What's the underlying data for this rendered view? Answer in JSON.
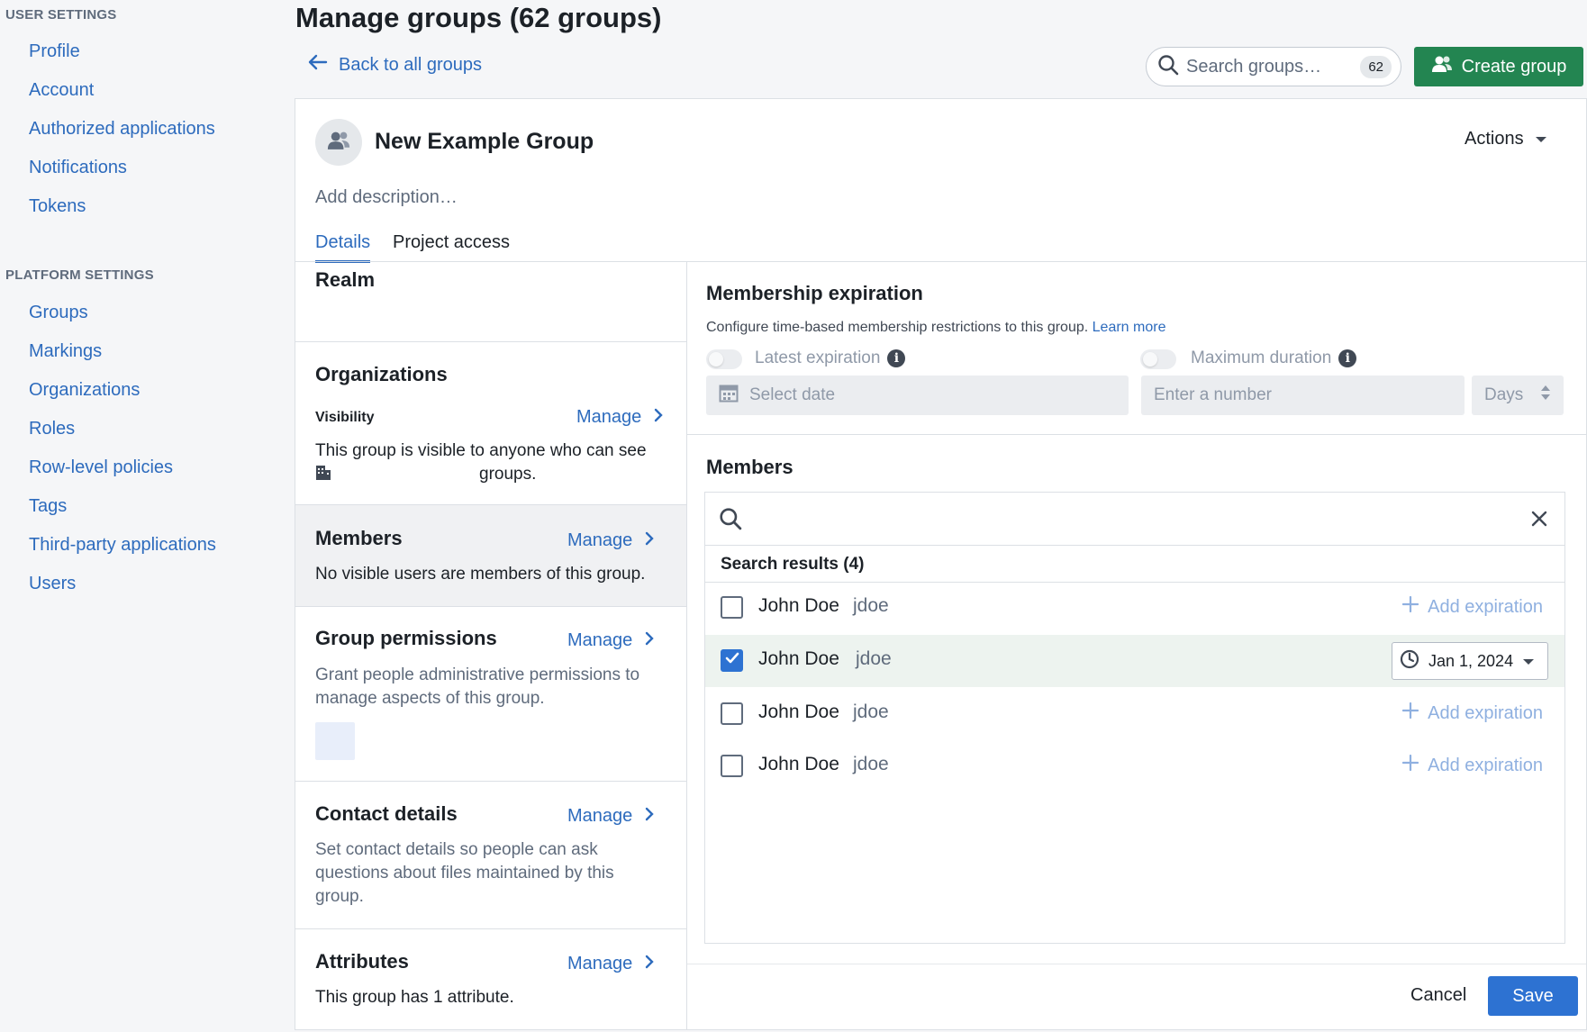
{
  "sidebar": {
    "user_heading": "USER SETTINGS",
    "user_items": [
      "Profile",
      "Account",
      "Authorized applications",
      "Notifications",
      "Tokens"
    ],
    "platform_heading": "PLATFORM SETTINGS",
    "platform_items": [
      "Groups",
      "Markings",
      "Organizations",
      "Roles",
      "Row-level policies",
      "Tags",
      "Third-party applications",
      "Users"
    ]
  },
  "header": {
    "title": "Manage groups (62 groups)",
    "back_label": "Back to all groups",
    "search_placeholder": "Search groups…",
    "search_count": "62",
    "create_label": "Create group"
  },
  "group": {
    "name": "New Example Group",
    "actions_label": "Actions",
    "description_placeholder": "Add description…",
    "tabs": [
      "Details",
      "Project access"
    ]
  },
  "details": {
    "realm_title": "Realm",
    "org_title": "Organizations",
    "visibility_label": "Visibility",
    "visibility_text_1": "This group is visible to anyone who can see",
    "visibility_text_2": "groups.",
    "members_title": "Members",
    "members_text": "No visible users are members of this group.",
    "perm_title": "Group permissions",
    "perm_text": "Grant people administrative permissions to manage aspects of this group.",
    "contact_title": "Contact details",
    "contact_text": "Set contact details so people can ask questions about files maintained by this group.",
    "attr_title": "Attributes",
    "attr_text": "This group has 1 attribute.",
    "manage_label": "Manage"
  },
  "expiration": {
    "title": "Membership expiration",
    "description": "Configure time-based membership restrictions to this group.",
    "learn_more": "Learn more",
    "latest_label": "Latest expiration",
    "max_label": "Maximum duration",
    "date_placeholder": "Select date",
    "number_placeholder": "Enter a number",
    "unit": "Days"
  },
  "members": {
    "title": "Members",
    "results_label": "Search results (4)",
    "add_expiration_label": "Add expiration",
    "rows": [
      {
        "name": "John Doe",
        "username": "jdoe",
        "checked": false,
        "expiration": ""
      },
      {
        "name": "John Doe",
        "username": "jdoe",
        "checked": true,
        "expiration": "Jan 1, 2024"
      },
      {
        "name": "John Doe",
        "username": "jdoe",
        "checked": false,
        "expiration": ""
      },
      {
        "name": "John Doe",
        "username": "jdoe",
        "checked": false,
        "expiration": ""
      }
    ]
  },
  "footer": {
    "cancel_label": "Cancel",
    "save_label": "Save"
  },
  "colors": {
    "link": "#2d6bbd",
    "primary": "#2d72d2",
    "success": "#238551"
  }
}
